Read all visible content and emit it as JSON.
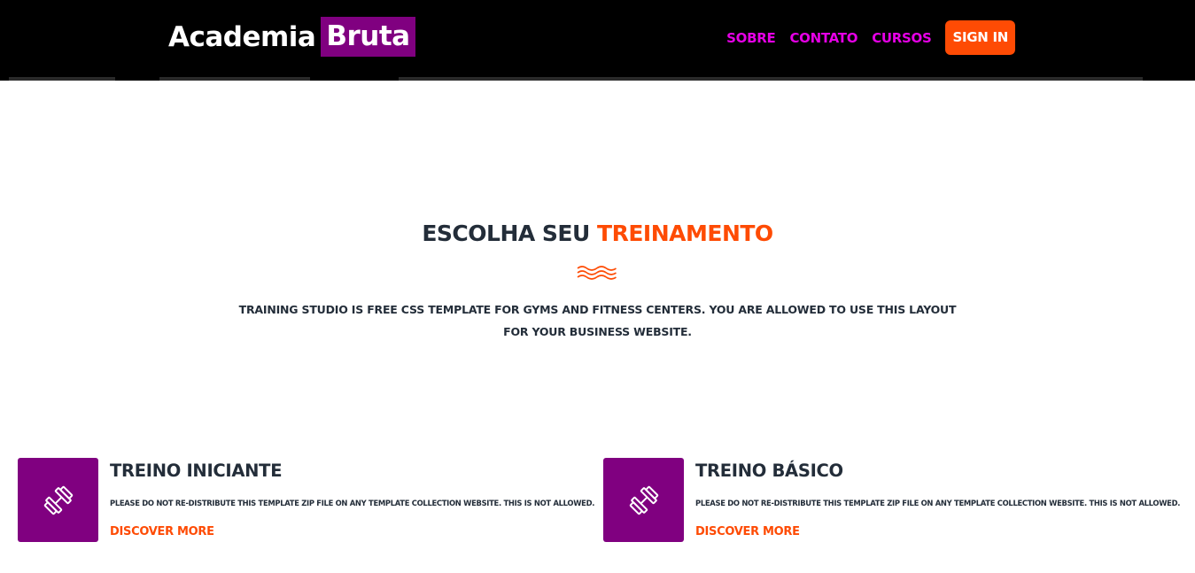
{
  "header": {
    "logo_main": "Academia",
    "logo_accent": "Bruta",
    "nav": [
      {
        "label": "SOBRE"
      },
      {
        "label": "CONTATO"
      },
      {
        "label": "CURSOS"
      }
    ],
    "signin_label": "SIGN IN"
  },
  "section": {
    "title_main": "ESCOLHA SEU",
    "title_highlight": "TREINAMENTO",
    "subtitle": "TRAINING STUDIO IS FREE CSS TEMPLATE FOR GYMS AND FITNESS CENTERS. YOU ARE ALLOWED TO USE THIS LAYOUT FOR YOUR BUSINESS WEBSITE."
  },
  "cards": [
    {
      "icon": "dumbbell-icon",
      "title": "TREINO INICIANTE",
      "description": "PLEASE DO NOT RE-DISTRIBUTE THIS TEMPLATE ZIP FILE ON ANY TEMPLATE COLLECTION WEBSITE. THIS IS NOT ALLOWED.",
      "link": "DISCOVER MORE"
    },
    {
      "icon": "dumbbell-icon",
      "title": "TREINO BÁSICO",
      "description": "PLEASE DO NOT RE-DISTRIBUTE THIS TEMPLATE ZIP FILE ON ANY TEMPLATE COLLECTION WEBSITE. THIS IS NOT ALLOWED.",
      "link": "DISCOVER MORE"
    }
  ],
  "colors": {
    "header_bg": "#000000",
    "brand_purple": "#800080",
    "nav_magenta": "#e600e6",
    "accent_orange": "#fe4b04",
    "text_dark": "#232d39"
  }
}
